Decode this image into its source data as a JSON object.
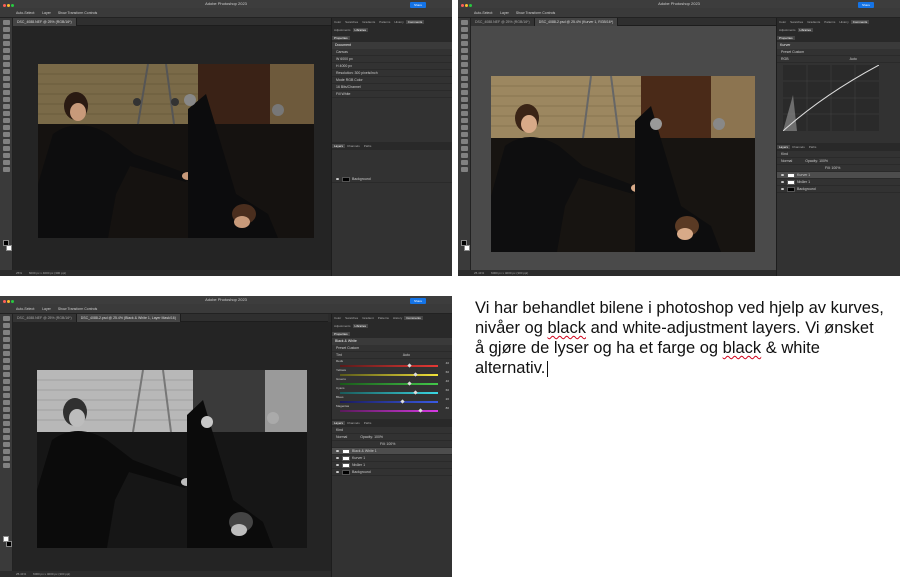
{
  "app_title": "Adobe Photoshop 2023",
  "options": {
    "auto_select": "Auto-Select:",
    "layer_value": "Layer",
    "show_transform": "Show Transform Controls",
    "share_label": "Share"
  },
  "windows": {
    "top_left": {
      "tab": "DSC_4088.NEF @ 25% (RGB/16*)",
      "status": "25%",
      "status_doc": "6000 px x 4000 px (300 ppi)",
      "panel_tabs": [
        "Color",
        "Swatches",
        "Gradients",
        "Patterns",
        "History",
        "Comments"
      ],
      "adj_tabs": [
        "Adjustments",
        "Libraries"
      ],
      "props_title": "Properties",
      "props_sub": "Document",
      "canvas_label": "Canvas",
      "width_value": "6000 px",
      "height_value": "4000 px",
      "resolution": "Resolution: 300 pixels/inch",
      "mode_label": "Mode",
      "mode_value": "RGB Color",
      "bits_value": "16 Bits/Channel",
      "fill_label": "Fill",
      "fill_value": "White",
      "layers_tabs": [
        "Layers",
        "Channels",
        "Paths"
      ],
      "layer_name": "Background"
    },
    "top_right": {
      "tabs": [
        "DSC_4088.NEF @ 25% (RGB/16*)",
        "DSC_4088-2.psd @ 25.4% (Kurver 1, RGB/16*)"
      ],
      "status": "25.41%",
      "status_doc": "6000 px x 4000 px (300 ppi)",
      "panel_tabs": [
        "Color",
        "Swatches",
        "Gradients",
        "Patterns",
        "History",
        "Comments"
      ],
      "adj_tabs": [
        "Adjustments",
        "Libraries"
      ],
      "props_title": "Properties",
      "props_sub": "Kurver",
      "preset_label": "Preset",
      "preset_value": "Custom",
      "channel_value": "RGB",
      "auto_label": "Auto",
      "layers_tabs": [
        "Layers",
        "Channels",
        "Paths"
      ],
      "kind_label": "Kind",
      "blend_value": "Normal",
      "opacity": "Opacity: 100%",
      "fill": "Fill: 100%",
      "layers": [
        "Kurver 1",
        "Nivåer 1",
        "Background"
      ]
    },
    "bottom_left": {
      "tabs": [
        "DSC_4088.NEF @ 25% (RGB/16*)",
        "DSC_4088-2.psd @ 25.4% (Black & White 1, Layer Mask/16)"
      ],
      "status": "25.41%",
      "status_doc": "6000 px x 4000 px (300 ppi)",
      "panel_tabs": [
        "Color",
        "Swatches",
        "Gradient",
        "Patterns",
        "History",
        "Comments"
      ],
      "adj_tabs": [
        "Adjustments",
        "Libraries"
      ],
      "props_title": "Properties",
      "props_sub": "Black & White",
      "preset_label": "Preset",
      "preset_value": "Custom",
      "tint_label": "Tint",
      "auto_label": "Auto",
      "sliders": [
        {
          "name": "Reds",
          "value": "40",
          "level": 0.69,
          "gradient": "linear-gradient(90deg,#5a1a1a,#e53935)"
        },
        {
          "name": "Yellows",
          "value": "60",
          "level": 0.75,
          "gradient": "linear-gradient(90deg,#5a5a1a,#f2e23a)"
        },
        {
          "name": "Greens",
          "value": "40",
          "level": 0.69,
          "gradient": "linear-gradient(90deg,#1a5a1a,#43c74a)"
        },
        {
          "name": "Cyans",
          "value": "60",
          "level": 0.75,
          "gradient": "linear-gradient(90deg,#1a5a5a,#3ad6e2)"
        },
        {
          "name": "Blues",
          "value": "20",
          "level": 0.62,
          "gradient": "linear-gradient(90deg,#1a1a5a,#3a5ae2)"
        },
        {
          "name": "Magentas",
          "value": "80",
          "level": 0.81,
          "gradient": "linear-gradient(90deg,#5a1a5a,#d63ae2)"
        }
      ],
      "layers_tabs": [
        "Layers",
        "Channels",
        "Paths"
      ],
      "kind_label": "Kind",
      "blend_value": "Normal",
      "opacity": "Opacity: 100%",
      "fill": "Fill: 100%",
      "layers": [
        "Black & White 1",
        "Kurver 1",
        "Nivåer 1",
        "Background"
      ]
    }
  },
  "note": {
    "text_parts": [
      "Vi har behandlet bilene i photoshop ved hjelp av kurves, nivåer og ",
      "black",
      " and white-adjustment layers. Vi ønsket å gjøre de lyser og ha et farge og ",
      "black",
      " & white alternativ."
    ]
  },
  "colors": {
    "share_blue": "#1473e6",
    "workspace": "#2b2b2b",
    "panel": "#323232",
    "squiggle": "#d0021b"
  }
}
